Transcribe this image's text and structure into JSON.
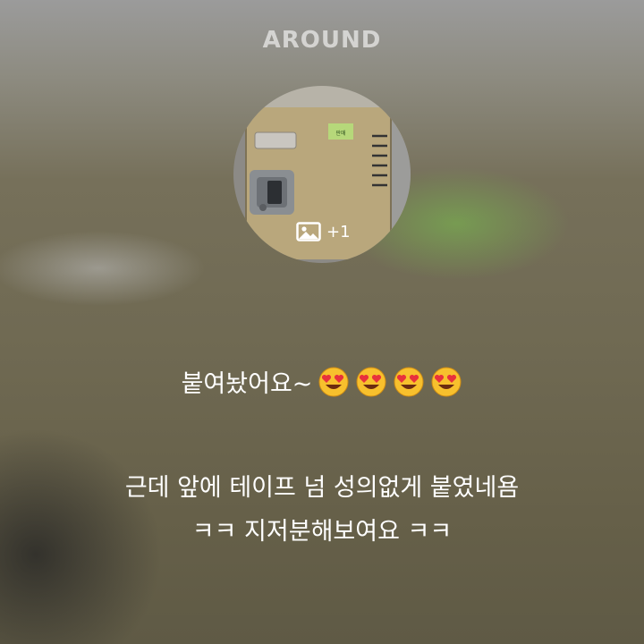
{
  "brand": {
    "logo_text": "AROUND"
  },
  "photo": {
    "image_icon": "image-icon",
    "count_label": "+1",
    "sticker_text": "판매"
  },
  "post": {
    "line1_text": "붙여놨어요~",
    "line1_emoji": "heart-eyes-emoji",
    "line1_emoji_count": 4,
    "line2_text": "근데 앞에 테이프 넘 성의없게 붙였네욤",
    "line3_text": "ㅋㅋ 지저분해보여요 ㅋㅋ"
  },
  "colors": {
    "text": "#ffffff",
    "locker": "#b9a77c",
    "emoji_face": "#f7c02d",
    "emoji_heart": "#e8313c"
  }
}
